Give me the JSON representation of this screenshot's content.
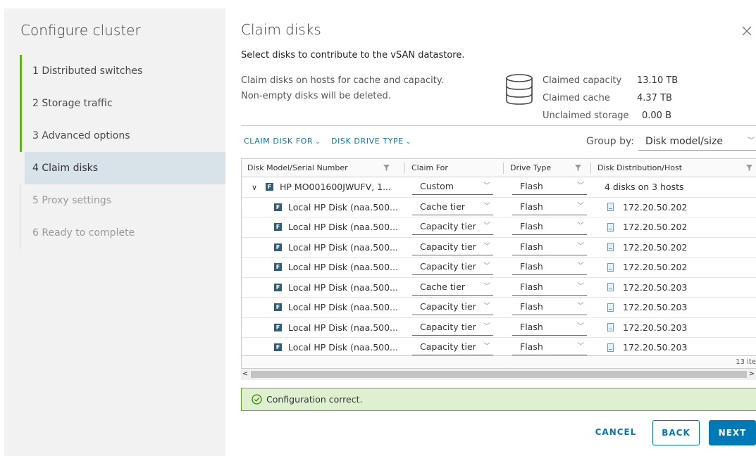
{
  "wizard": {
    "title": "Configure cluster",
    "steps": [
      {
        "label": "1 Distributed switches",
        "state": "done"
      },
      {
        "label": "2 Storage traffic",
        "state": "done"
      },
      {
        "label": "3 Advanced options",
        "state": "done"
      },
      {
        "label": "4 Claim disks",
        "state": "active"
      },
      {
        "label": "5 Proxy settings",
        "state": "disabled"
      },
      {
        "label": "6 Ready to complete",
        "state": "disabled"
      }
    ]
  },
  "main": {
    "title": "Claim disks",
    "subtitle": "Select disks to contribute to the vSAN datastore.",
    "desc_line1": "Claim disks on hosts for cache and capacity.",
    "desc_line2": "Non-empty disks will be deleted.",
    "summary": {
      "claimed_capacity_label": "Claimed capacity",
      "claimed_capacity_value": "13.10 TB",
      "claimed_cache_label": "Claimed cache",
      "claimed_cache_value": "4.37 TB",
      "unclaimed_storage_label": "Unclaimed storage",
      "unclaimed_storage_value": "0.00 B"
    },
    "actions": {
      "claim_disk_for": "CLAIM DISK FOR",
      "disk_drive_type": "DISK DRIVE TYPE"
    },
    "group_by": {
      "label": "Group by:",
      "value": "Disk model/size"
    },
    "grid": {
      "columns": [
        "Disk Model/Serial Number",
        "Claim For",
        "Drive Type",
        "Disk Distribution/Host"
      ],
      "group_row": {
        "badge": "F",
        "name": "HP MO001600JWUFV, 1...",
        "claim_for": "Custom",
        "drive_type": "Flash",
        "distribution": "4 disks on 3 hosts"
      },
      "rows": [
        {
          "badge": "F",
          "name": "Local HP Disk (naa.500...",
          "claim_for": "Cache tier",
          "drive_type": "Flash",
          "host": "172.20.50.202"
        },
        {
          "badge": "F",
          "name": "Local HP Disk (naa.500...",
          "claim_for": "Capacity tier",
          "drive_type": "Flash",
          "host": "172.20.50.202"
        },
        {
          "badge": "F",
          "name": "Local HP Disk (naa.500...",
          "claim_for": "Capacity tier",
          "drive_type": "Flash",
          "host": "172.20.50.202"
        },
        {
          "badge": "F",
          "name": "Local HP Disk (naa.500...",
          "claim_for": "Capacity tier",
          "drive_type": "Flash",
          "host": "172.20.50.202"
        },
        {
          "badge": "F",
          "name": "Local HP Disk (naa.500...",
          "claim_for": "Cache tier",
          "drive_type": "Flash",
          "host": "172.20.50.203"
        },
        {
          "badge": "F",
          "name": "Local HP Disk (naa.500...",
          "claim_for": "Capacity tier",
          "drive_type": "Flash",
          "host": "172.20.50.203"
        },
        {
          "badge": "F",
          "name": "Local HP Disk (naa.500...",
          "claim_for": "Capacity tier",
          "drive_type": "Flash",
          "host": "172.20.50.203"
        },
        {
          "badge": "F",
          "name": "Local HP Disk (naa.500...",
          "claim_for": "Capacity tier",
          "drive_type": "Flash",
          "host": "172.20.50.203"
        }
      ],
      "footer": "13 ite"
    },
    "alert": {
      "text": "Configuration correct."
    },
    "buttons": {
      "cancel": "CANCEL",
      "back": "BACK",
      "next": "NEXT"
    }
  },
  "colors": {
    "accent": "#0079b8",
    "success": "#60b515",
    "success_bg": "#dff0d0",
    "active_step_bg": "#d8e3e9",
    "disk_badge": "#2d6076"
  },
  "icons": [
    "close-icon",
    "database-icon",
    "chevron-down-icon",
    "filter-icon",
    "expand-icon",
    "disk-badge-icon",
    "host-icon",
    "check-circle-icon",
    "chevron-left-icon",
    "chevron-right-icon"
  ]
}
